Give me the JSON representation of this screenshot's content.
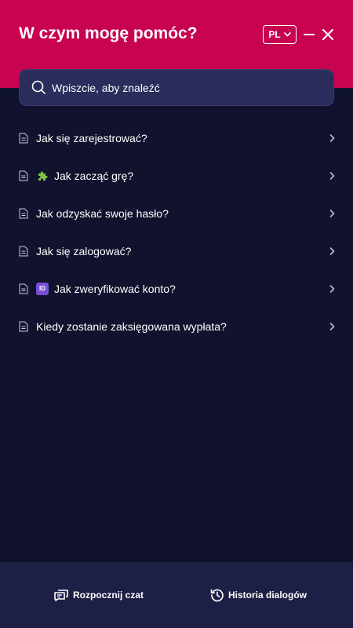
{
  "header": {
    "title": "W czym mogę pomóc?",
    "language": "PL",
    "background": "#c8034f"
  },
  "search": {
    "placeholder": "Wpiszcie, aby znaleźć",
    "value": ""
  },
  "faq": [
    {
      "label": "Jak się zarejestrować?",
      "icon": "document-icon"
    },
    {
      "label": "Jak zacząć grę?",
      "icon": "document-icon",
      "emoji": "puzzle-piece-emoji"
    },
    {
      "label": "Jak odzyskać swoje hasło?",
      "icon": "document-icon"
    },
    {
      "label": "Jak się zalogować?",
      "icon": "document-icon"
    },
    {
      "label": "Jak zweryfikować konto?",
      "icon": "document-icon",
      "emoji": "id-emoji",
      "emoji_text": "ID"
    },
    {
      "label": "Kiedy zostanie zaksięgowana wypłata?",
      "icon": "document-icon"
    }
  ],
  "footer": {
    "start_chat": "Rozpocznij czat",
    "history": "Historia dialogów"
  },
  "colors": {
    "background": "#11122d",
    "search_bg": "#2b2d5c",
    "footer_bg": "#1d1f45"
  }
}
